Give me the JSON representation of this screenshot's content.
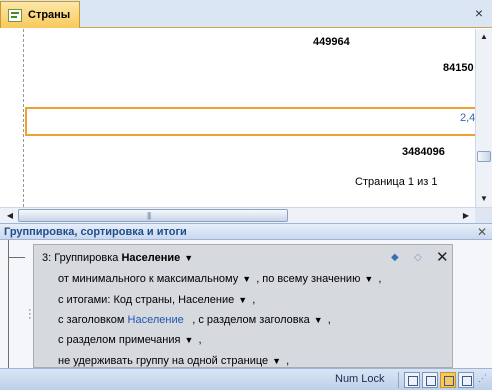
{
  "tab": {
    "label": "Страны",
    "icon": "report-form-icon"
  },
  "report": {
    "values": [
      "449964",
      "84150",
      "2,4",
      "3484096"
    ],
    "page_indicator": "Страница 1 из 1"
  },
  "grouping_pane": {
    "title": "Группировка, сортировка и итоги",
    "level_prefix": "3:  Группировка",
    "field": "Население",
    "order": "от минимального к максимальному",
    "by_value": ", по всему значению",
    "totals": "с итогами: Код страны, Население",
    "header_prefix": "с заголовком",
    "header_field": "Население",
    "header_section": ", с разделом заголовка",
    "footer_section": "с разделом примечания",
    "keep_together": "не удерживать группу на одной странице",
    "trailing_comma": ","
  },
  "status_bar": {
    "numlock": "Num Lock"
  },
  "colors": {
    "selection": "#f0a030",
    "tab": "#f8c95b",
    "pane_title": "#1f4e8c",
    "link": "#1d56b3"
  }
}
